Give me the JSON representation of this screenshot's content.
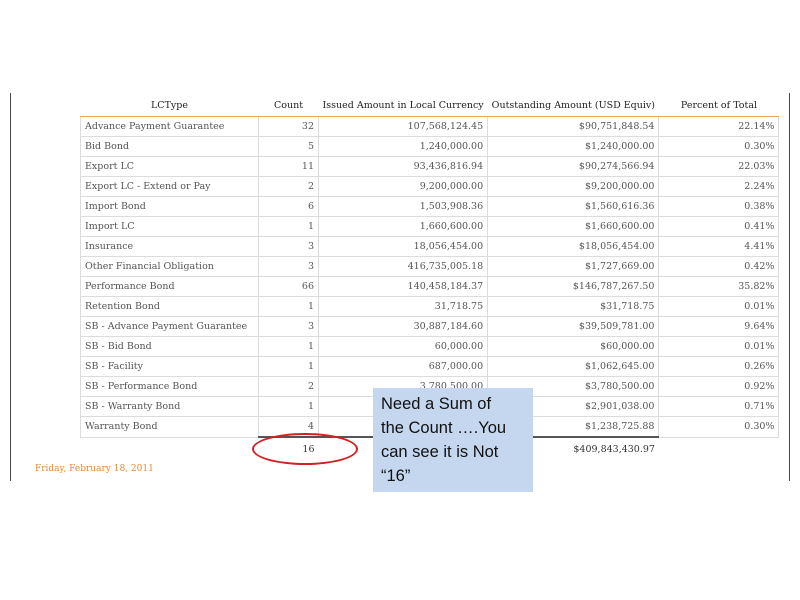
{
  "table": {
    "headers": [
      "LCType",
      "Count",
      "Issued Amount in Local Currency",
      "Outstanding Amount (USD Equiv)",
      "Percent of Total"
    ],
    "rows": [
      [
        "Advance Payment Guarantee",
        "32",
        "107,568,124.45",
        "$90,751,848.54",
        "22.14%"
      ],
      [
        "Bid Bond",
        "5",
        "1,240,000.00",
        "$1,240,000.00",
        "0.30%"
      ],
      [
        "Export LC",
        "11",
        "93,436,816.94",
        "$90,274,566.94",
        "22.03%"
      ],
      [
        "Export LC - Extend or Pay",
        "2",
        "9,200,000.00",
        "$9,200,000.00",
        "2.24%"
      ],
      [
        "Import Bond",
        "6",
        "1,503,908.36",
        "$1,560,616.36",
        "0.38%"
      ],
      [
        "Import LC",
        "1",
        "1,660,600.00",
        "$1,660,600.00",
        "0.41%"
      ],
      [
        "Insurance",
        "3",
        "18,056,454.00",
        "$18,056,454.00",
        "4.41%"
      ],
      [
        "Other Financial Obligation",
        "3",
        "416,735,005.18",
        "$1,727,669.00",
        "0.42%"
      ],
      [
        "Performance Bond",
        "66",
        "140,458,184.37",
        "$146,787,267.50",
        "35.82%"
      ],
      [
        "Retention Bond",
        "1",
        "31,718.75",
        "$31,718.75",
        "0.01%"
      ],
      [
        "SB - Advance Payment Guarantee",
        "3",
        "30,887,184.60",
        "$39,509,781.00",
        "9.64%"
      ],
      [
        "SB - Bid Bond",
        "1",
        "60,000.00",
        "$60,000.00",
        "0.01%"
      ],
      [
        "SB - Facility",
        "1",
        "687,000.00",
        "$1,062,645.00",
        "0.26%"
      ],
      [
        "SB - Performance Bond",
        "2",
        "3,780,500.00",
        "$3,780,500.00",
        "0.92%"
      ],
      [
        "SB - Warranty Bond",
        "1",
        "",
        "$2,901,038.00",
        "0.71%"
      ],
      [
        "Warranty Bond",
        "4",
        "",
        "$1,238,725.88",
        "0.30%"
      ]
    ],
    "total": {
      "count": "16",
      "outstanding": "$409,843,430.97"
    }
  },
  "footer": {
    "date": "Friday, February 18, 2011"
  },
  "callout": {
    "lines": [
      "Need a Sum of",
      "the Count ….You",
      "can see it is Not",
      "“16”"
    ]
  },
  "colors": {
    "callout_bg": "#c5d7ee",
    "oval": "#d42020",
    "date": "#e08a3a",
    "header_rule": "#e8a25a"
  }
}
